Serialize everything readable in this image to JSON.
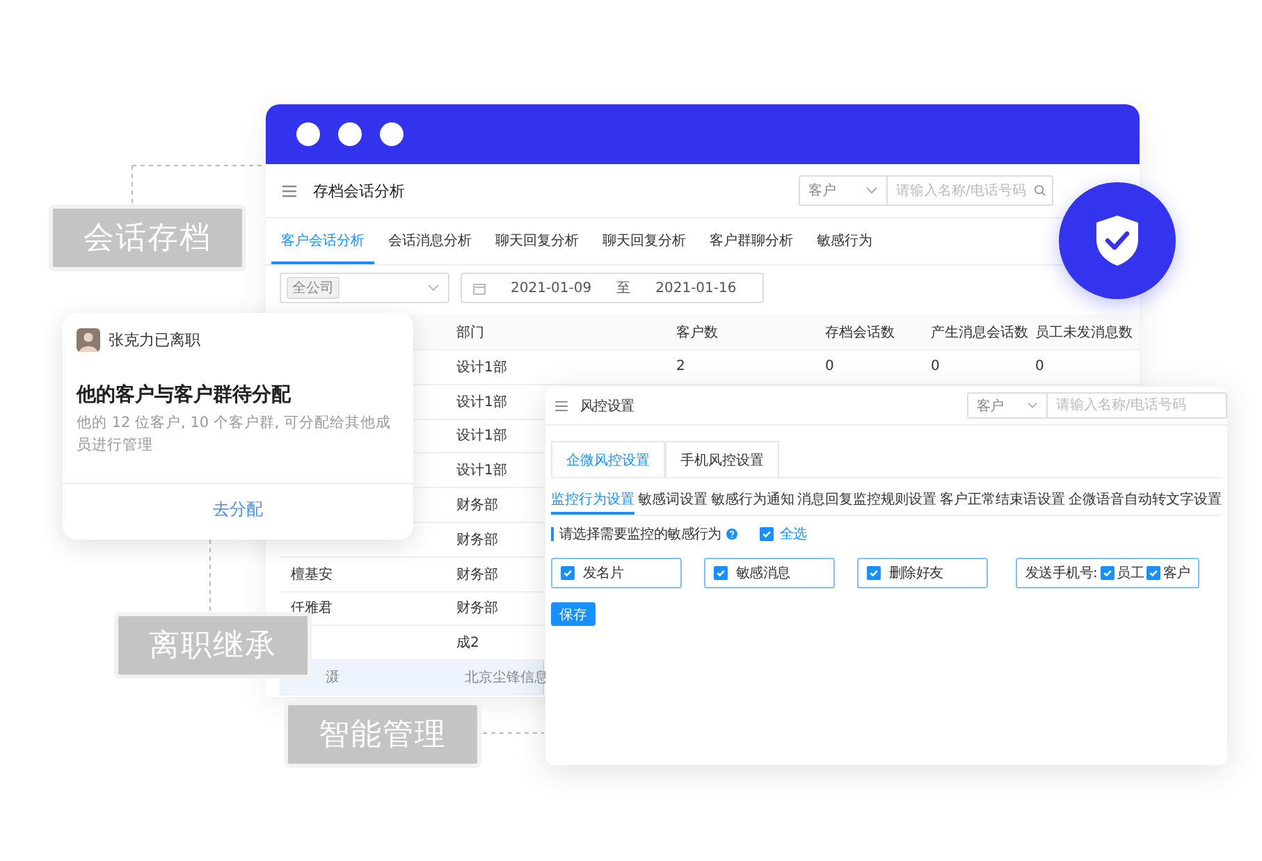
{
  "main_window": {
    "title": "存档会话分析",
    "search": {
      "scope": "客户",
      "placeholder": "请输入名称/电话号码"
    },
    "tabs": [
      {
        "label": "客户会话分析",
        "selected": true
      },
      {
        "label": "会话消息分析",
        "selected": false
      },
      {
        "label": "聊天回复分析",
        "selected": false
      },
      {
        "label": "聊天回复分析",
        "selected": false
      },
      {
        "label": "客户群聊分析",
        "selected": false
      },
      {
        "label": "敏感行为",
        "selected": false
      }
    ],
    "filter": {
      "company": "全公司",
      "date_from": "2021-01-09",
      "date_separator": "至",
      "date_to": "2021-01-16"
    },
    "table": {
      "columns": [
        "部门",
        "客户数",
        "存档会话数",
        "产生消息会话数",
        "员工未发消息数"
      ],
      "rows": [
        {
          "department": "设计1部",
          "values": [
            "2",
            "0",
            "0",
            "0"
          ],
          "selected": false
        },
        {
          "department": "设计1部",
          "selected": false
        },
        {
          "department": "设计1部",
          "selected": false
        },
        {
          "department": "设计1部",
          "selected": false
        },
        {
          "department": "财务部",
          "selected": false
        },
        {
          "department": "财务部",
          "selected": false
        },
        {
          "name": "檀基安",
          "department": "财务部",
          "selected": false
        },
        {
          "name": "仟雅君",
          "department": "财务部",
          "selected": false
        },
        {
          "department": "成2",
          "selected": false
        },
        {
          "name": "滠",
          "department": "北京尘锋信息",
          "selected": true
        }
      ]
    }
  },
  "notice_card": {
    "person": "张克力已离职",
    "title": "他的客户与客户群待分配",
    "message": "他的 12 位客户, 10 个客户群, 可分配给其他成员进行管理",
    "action": "去分配"
  },
  "feature_labels": [
    "会话存档",
    "离职继承",
    "智能管理"
  ],
  "risk_window": {
    "title": "风控设置",
    "search": {
      "scope": "客户",
      "placeholder": "请输入名称/电话号码"
    },
    "tabs": [
      {
        "label": "企微风控设置",
        "selected": true
      },
      {
        "label": "手机风控设置",
        "selected": false
      }
    ],
    "subtabs": [
      {
        "label": "监控行为设置",
        "selected": true
      },
      {
        "label": "敏感词设置",
        "selected": false
      },
      {
        "label": "敏感行为通知",
        "selected": false
      },
      {
        "label": "消息回复监控规则设置",
        "selected": false
      },
      {
        "label": "客户正常结束语设置",
        "selected": false
      },
      {
        "label": "企微语音自动转文字设置",
        "selected": false
      }
    ],
    "section_label": "请选择需要监控的敏感行为",
    "select_all": {
      "label": "全选",
      "checked": true
    },
    "options": [
      {
        "kind": "checkbox",
        "label": "发名片",
        "checked": true
      },
      {
        "kind": "checkbox",
        "label": "敏感消息",
        "checked": true
      },
      {
        "kind": "checkbox",
        "label": "删除好友",
        "checked": true
      },
      {
        "kind": "group",
        "label": "发送手机号:",
        "choices": [
          {
            "label": "员工",
            "checked": true
          },
          {
            "label": "客户",
            "checked": true
          }
        ]
      }
    ],
    "save": "保存"
  }
}
